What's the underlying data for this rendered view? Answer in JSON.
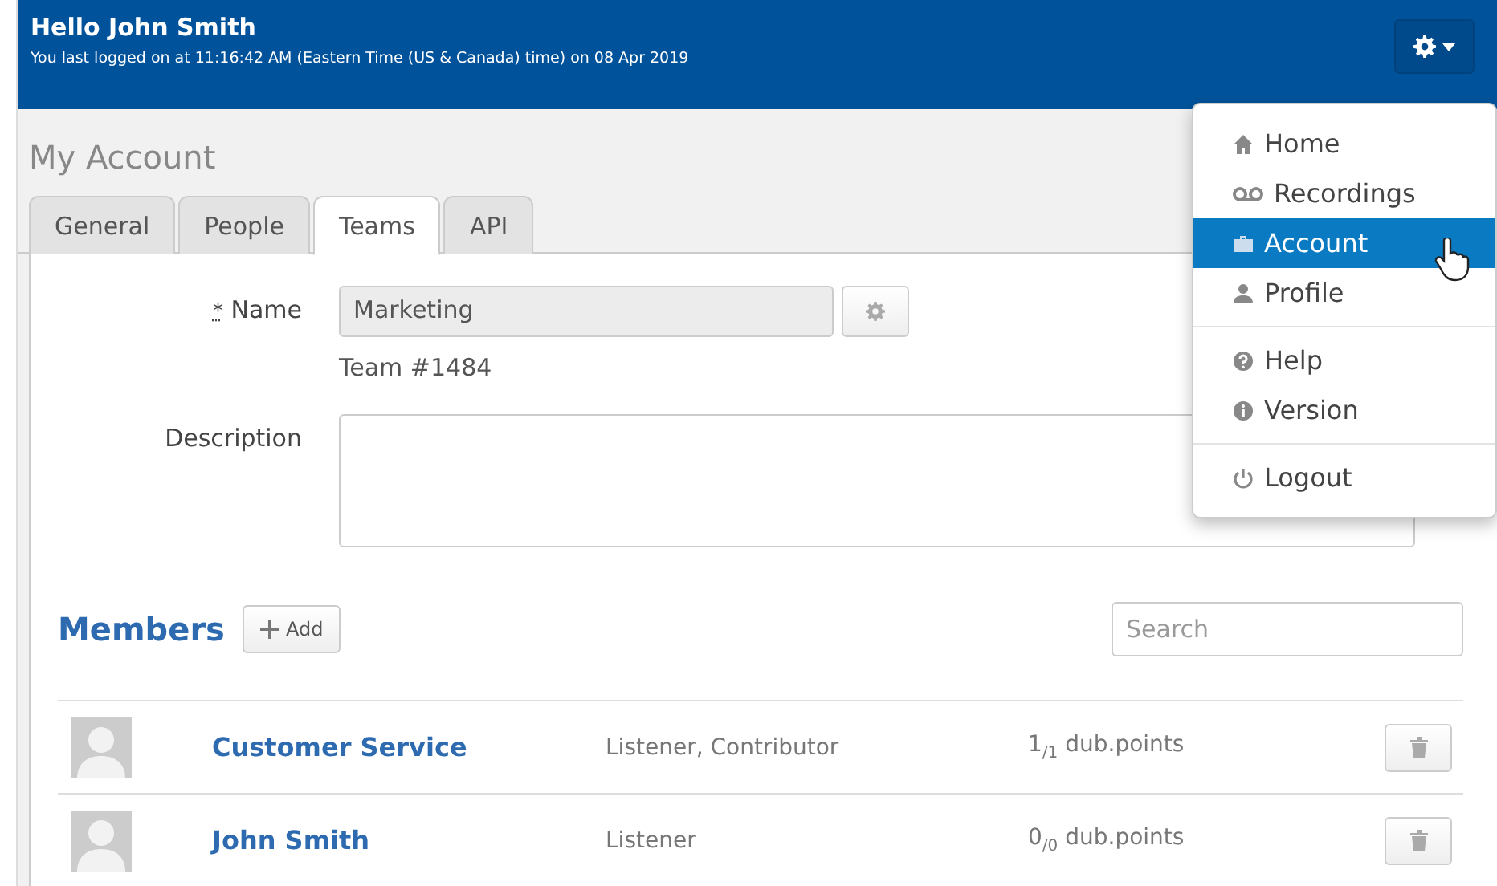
{
  "header": {
    "greeting": "Hello John Smith",
    "last_login": "You last logged on at 11:16:42 AM (Eastern Time (US & Canada) time) on 08 Apr 2019"
  },
  "page_title": "My Account",
  "tabs": [
    {
      "label": "General",
      "selected": false
    },
    {
      "label": "People",
      "selected": false
    },
    {
      "label": "Teams",
      "selected": true
    },
    {
      "label": "API",
      "selected": false
    }
  ],
  "form": {
    "name_required_mark": "*",
    "name_label": "Name",
    "name_value": "Marketing",
    "team_id": "Team #1484",
    "description_label": "Description"
  },
  "members": {
    "title": "Members",
    "add_label": "Add",
    "search_placeholder": "Search",
    "rows": [
      {
        "name": "Customer Service",
        "roles": "Listener, Contributor",
        "points": "1$_{/1}$ dub.points"
      },
      {
        "name": "John Smith",
        "roles": "Listener",
        "points": "0$_{/0}$ dub.points"
      }
    ]
  },
  "menu": {
    "groups": [
      [
        {
          "kind": "home",
          "label": "Home",
          "selected": false
        },
        {
          "kind": "recordings",
          "label": "Recordings",
          "selected": false
        },
        {
          "kind": "account",
          "label": "Account",
          "selected": true
        },
        {
          "kind": "profile",
          "label": "Profile",
          "selected": false
        }
      ],
      [
        {
          "kind": "help",
          "label": "Help",
          "selected": false
        },
        {
          "kind": "version",
          "label": "Version",
          "selected": false
        }
      ],
      [
        {
          "kind": "logout",
          "label": "Logout",
          "selected": false
        }
      ]
    ]
  }
}
